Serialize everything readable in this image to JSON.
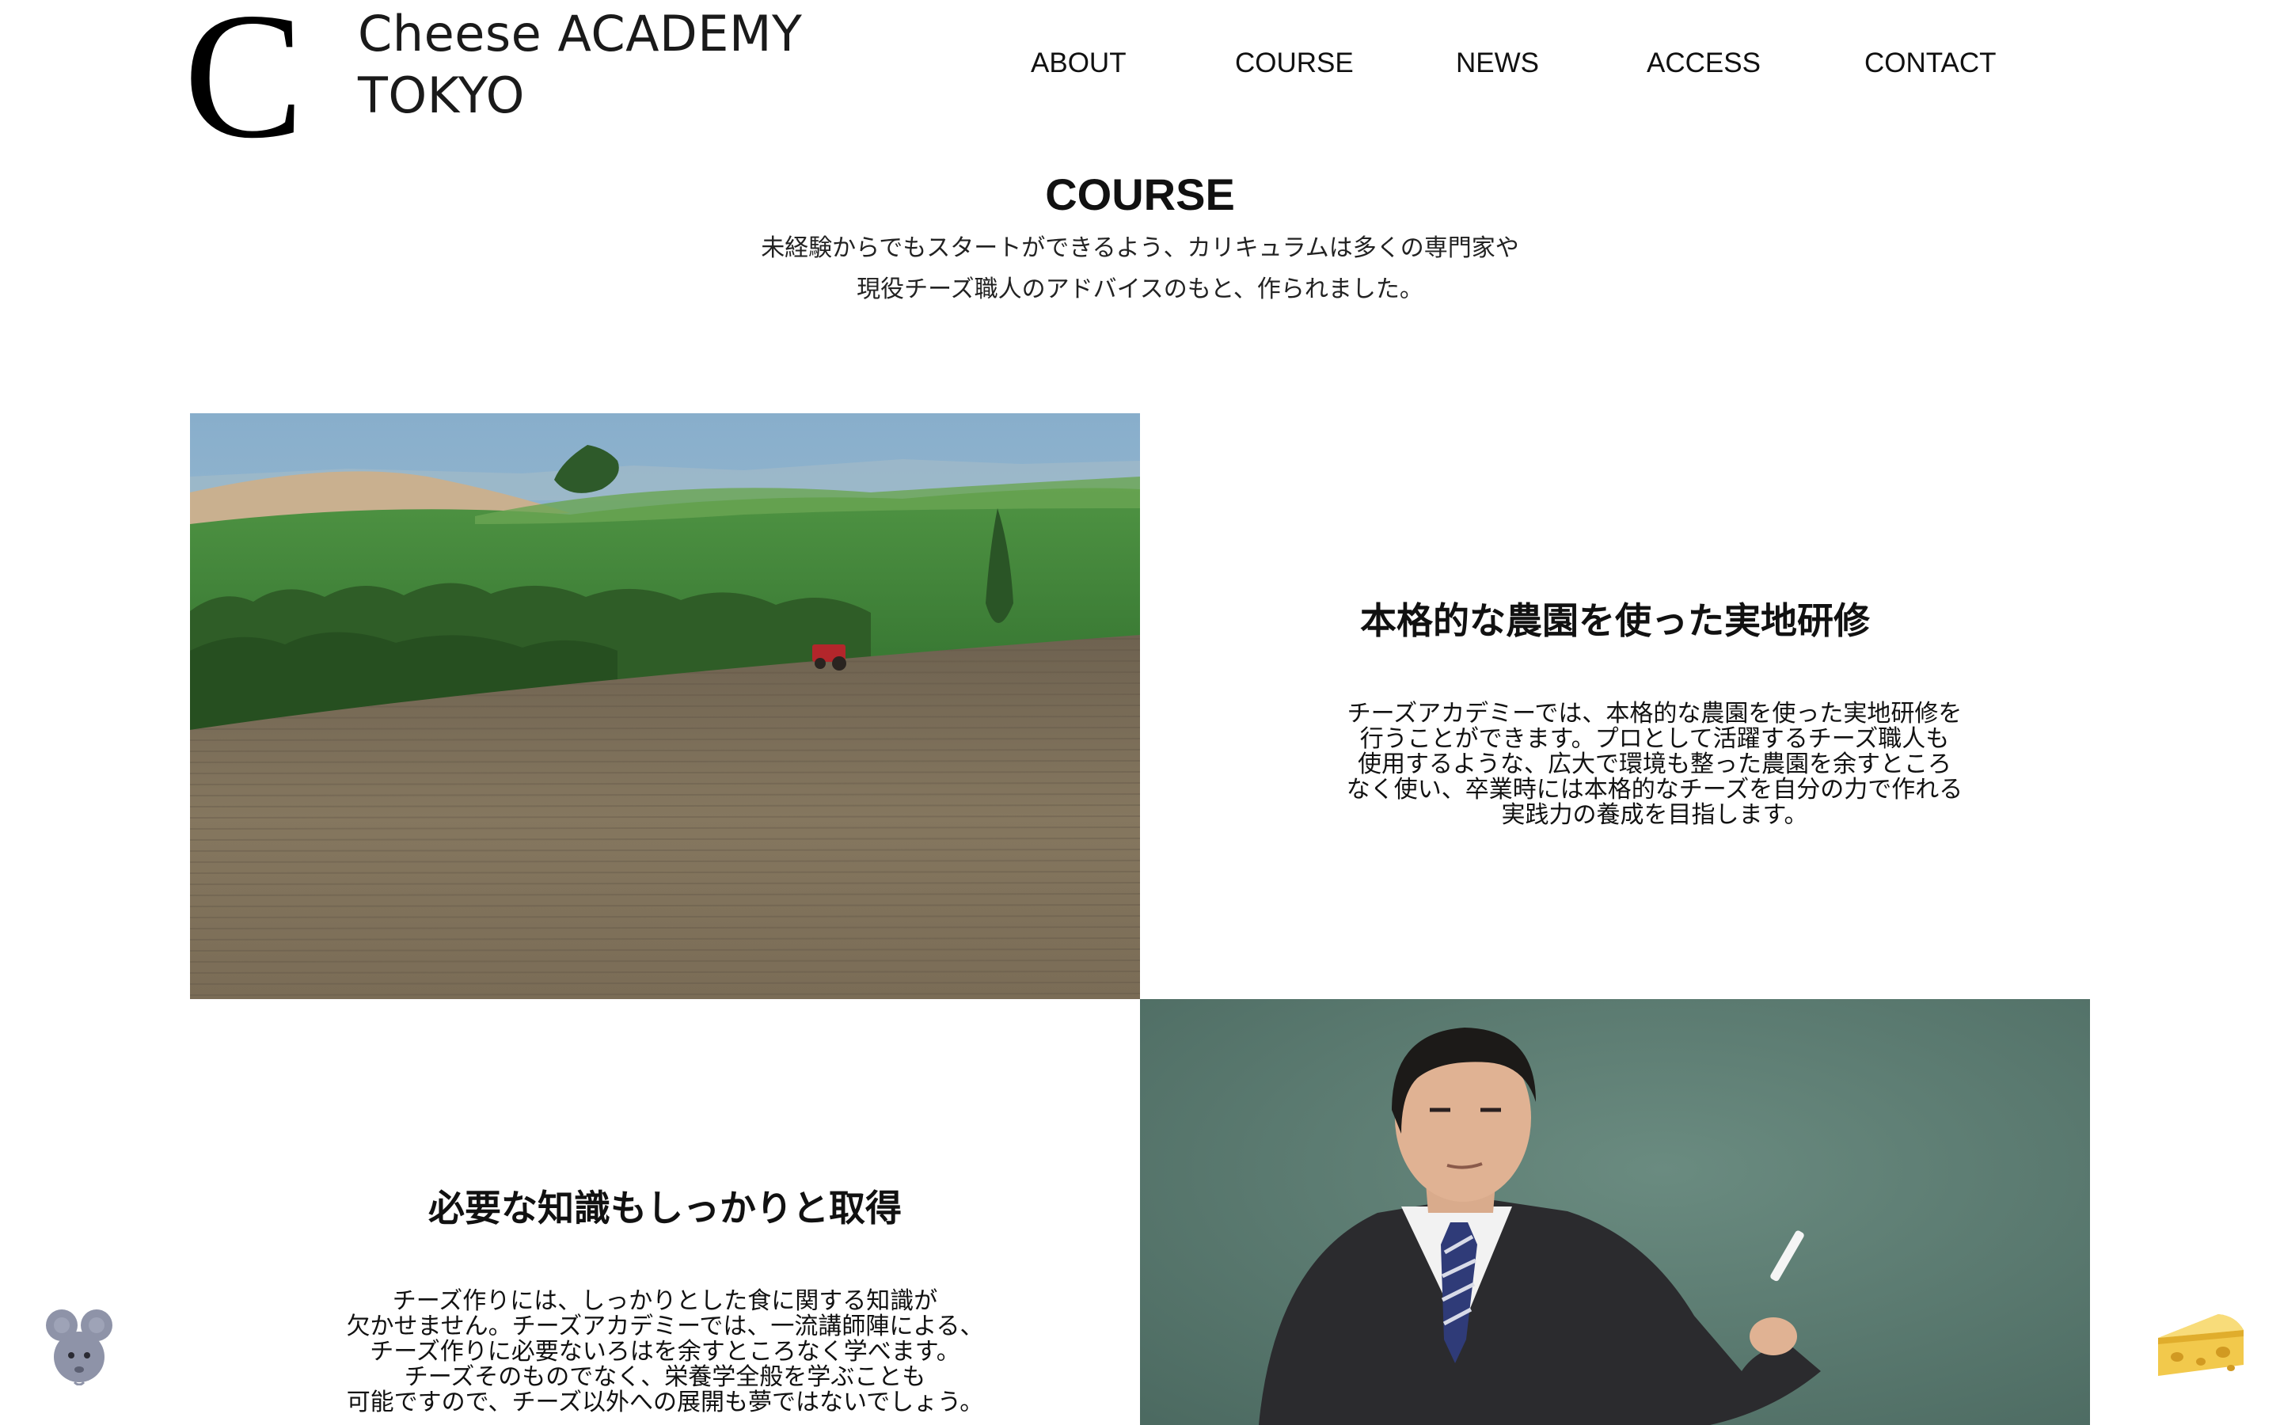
{
  "header": {
    "logo_letter": "C",
    "logo_line1": "Cheese ACADEMY",
    "logo_line2": "TOKYO",
    "nav": [
      "ABOUT",
      "COURSE",
      "NEWS",
      "ACCESS",
      "CONTACT"
    ]
  },
  "section": {
    "title": "COURSE",
    "lead": [
      "未経験からでもスタートができるよう、カリキュラムは多くの専門家や",
      "現役チーズ職人のアドバイスのもと、作られました。"
    ]
  },
  "blocks": [
    {
      "title": "本格的な農園を使った実地研修",
      "body": [
        "チーズアカデミーでは、本格的な農園を使った実地研修を",
        "行うことができます。プロとして活躍するチーズ職人も",
        "使用するような、広大で環境も整った農園を余すところ",
        "なく使い、卒業時には本格的なチーズを自分の力で作れる",
        "実践力の養成を目指します。"
      ],
      "image": "farm-field-photo"
    },
    {
      "title": "必要な知識もしっかりと取得",
      "body": [
        "チーズ作りには、しっかりとした食に関する知識が",
        "欠かせません。チーズアカデミーでは、一流講師陣による、",
        "チーズ作りに必要ないろはを余すところなく学べます。",
        "チーズそのものでなく、栄養学全般を学ぶことも",
        "可能ですので、チーズ以外への展開も夢ではないでしょう。"
      ],
      "image": "teacher-blackboard-photo"
    }
  ],
  "floating": {
    "left": "mouse-icon",
    "right": "cheese-icon"
  },
  "colors": {
    "text": "#111111",
    "background": "#ffffff",
    "mouse": "#8e93a8",
    "cheese": "#f2c94c"
  }
}
